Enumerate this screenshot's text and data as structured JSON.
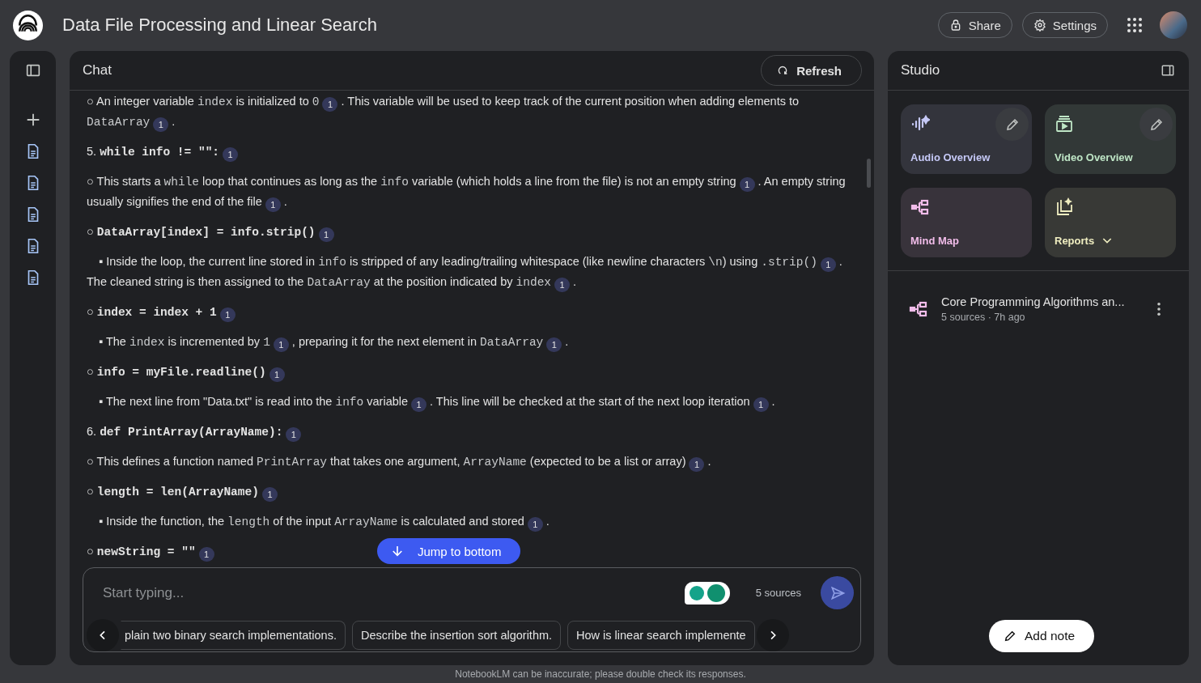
{
  "header": {
    "title": "Data File Processing and Linear Search",
    "buttons": [
      {
        "kind": "share",
        "label": "Share"
      },
      {
        "kind": "settings",
        "label": "Settings"
      }
    ]
  },
  "chat": {
    "title": "Chat",
    "refresh": "Refresh",
    "jump": "Jump to bottom",
    "outline": [
      {
        "children": [
          {
            "bullet": "○",
            "content": [
              {
                "kind": "text",
                "text": "An integer variable "
              },
              {
                "kind": "code",
                "text": "index"
              },
              {
                "kind": "text",
                "text": " is initialized to "
              },
              {
                "kind": "code",
                "text": "0"
              },
              {
                "kind": "cite",
                "text": "1"
              },
              {
                "kind": "text",
                "text": ". This variable will be used to keep track of the current position when adding elements to "
              },
              {
                "kind": "code",
                "text": "DataArray"
              },
              {
                "kind": "cite",
                "text": "1"
              },
              {
                "kind": "text",
                "text": "."
              }
            ]
          }
        ]
      },
      {
        "marker": "5.",
        "content": [
          {
            "kind": "bold-code",
            "text": "while info != \"\":"
          },
          {
            "kind": "cite",
            "text": "1"
          }
        ],
        "children": [
          {
            "bullet": "○",
            "content": [
              {
                "kind": "text",
                "text": "This starts a "
              },
              {
                "kind": "code",
                "text": "while"
              },
              {
                "kind": "text",
                "text": " loop that continues as long as the "
              },
              {
                "kind": "code",
                "text": "info"
              },
              {
                "kind": "text",
                "text": " variable (which holds a line from the file) is not an empty string"
              },
              {
                "kind": "cite",
                "text": "1"
              },
              {
                "kind": "text",
                "text": ". An empty string usually signifies the end of the file"
              },
              {
                "kind": "cite",
                "text": "1"
              },
              {
                "kind": "text",
                "text": "."
              }
            ]
          },
          {
            "bullet": "○",
            "content": [
              {
                "kind": "bold-code",
                "text": "DataArray[index] = info.strip()"
              },
              {
                "kind": "cite",
                "text": "1"
              }
            ],
            "children": [
              {
                "bullet": "▪",
                "content": [
                  {
                    "kind": "text",
                    "text": "Inside the loop, the current line stored in "
                  },
                  {
                    "kind": "code",
                    "text": "info"
                  },
                  {
                    "kind": "text",
                    "text": " is stripped of any leading/trailing whitespace (like newline characters "
                  },
                  {
                    "kind": "code",
                    "text": "\\n"
                  },
                  {
                    "kind": "text",
                    "text": ") using "
                  },
                  {
                    "kind": "code",
                    "text": ".strip()"
                  },
                  {
                    "kind": "cite",
                    "text": "1"
                  },
                  {
                    "kind": "text",
                    "text": ". The cleaned string is then assigned to the "
                  },
                  {
                    "kind": "code",
                    "text": "DataArray"
                  },
                  {
                    "kind": "text",
                    "text": " at the position indicated by "
                  },
                  {
                    "kind": "code",
                    "text": "index"
                  },
                  {
                    "kind": "cite",
                    "text": "1"
                  },
                  {
                    "kind": "text",
                    "text": "."
                  }
                ]
              }
            ]
          },
          {
            "bullet": "○",
            "content": [
              {
                "kind": "bold-code",
                "text": "index = index + 1"
              },
              {
                "kind": "cite",
                "text": "1"
              }
            ],
            "children": [
              {
                "bullet": "▪",
                "content": [
                  {
                    "kind": "text",
                    "text": "The "
                  },
                  {
                    "kind": "code",
                    "text": "index"
                  },
                  {
                    "kind": "text",
                    "text": " is incremented by "
                  },
                  {
                    "kind": "code",
                    "text": "1"
                  },
                  {
                    "kind": "cite",
                    "text": "1"
                  },
                  {
                    "kind": "text",
                    "text": ", preparing it for the next element in "
                  },
                  {
                    "kind": "code",
                    "text": "DataArray"
                  },
                  {
                    "kind": "cite",
                    "text": "1"
                  },
                  {
                    "kind": "text",
                    "text": "."
                  }
                ]
              }
            ]
          },
          {
            "bullet": "○",
            "content": [
              {
                "kind": "bold-code",
                "text": "info = myFile.readline()"
              },
              {
                "kind": "cite",
                "text": "1"
              }
            ],
            "children": [
              {
                "bullet": "▪",
                "content": [
                  {
                    "kind": "text",
                    "text": "The next line from \"Data.txt\" is read into the "
                  },
                  {
                    "kind": "code",
                    "text": "info"
                  },
                  {
                    "kind": "text",
                    "text": " variable"
                  },
                  {
                    "kind": "cite",
                    "text": "1"
                  },
                  {
                    "kind": "text",
                    "text": ". This line will be checked at the start of the next loop iteration"
                  },
                  {
                    "kind": "cite",
                    "text": "1"
                  },
                  {
                    "kind": "text",
                    "text": "."
                  }
                ]
              }
            ]
          }
        ]
      },
      {
        "marker": "6.",
        "content": [
          {
            "kind": "bold-code",
            "text": "def PrintArray(ArrayName):"
          },
          {
            "kind": "cite",
            "text": "1"
          }
        ],
        "children": [
          {
            "bullet": "○",
            "content": [
              {
                "kind": "text",
                "text": "This defines a function named "
              },
              {
                "kind": "code",
                "text": "PrintArray"
              },
              {
                "kind": "text",
                "text": " that takes one argument, "
              },
              {
                "kind": "code",
                "text": "ArrayName"
              },
              {
                "kind": "text",
                "text": " (expected to be a list or array)"
              },
              {
                "kind": "cite",
                "text": "1"
              },
              {
                "kind": "text",
                "text": "."
              }
            ]
          },
          {
            "bullet": "○",
            "content": [
              {
                "kind": "bold-code",
                "text": "length = len(ArrayName)"
              },
              {
                "kind": "cite",
                "text": "1"
              }
            ],
            "children": [
              {
                "bullet": "▪",
                "content": [
                  {
                    "kind": "text",
                    "text": "Inside the function, the "
                  },
                  {
                    "kind": "code",
                    "text": "length"
                  },
                  {
                    "kind": "text",
                    "text": " of the input "
                  },
                  {
                    "kind": "code",
                    "text": "ArrayName"
                  },
                  {
                    "kind": "text",
                    "text": " is calculated and stored"
                  },
                  {
                    "kind": "cite",
                    "text": "1"
                  },
                  {
                    "kind": "text",
                    "text": "."
                  }
                ]
              }
            ]
          },
          {
            "bullet": "○",
            "content": [
              {
                "kind": "bold-code",
                "text": "newString = \"\""
              },
              {
                "kind": "cite",
                "text": "1"
              }
            ]
          }
        ]
      }
    ],
    "input": {
      "placeholder": "Start typing...",
      "sources": "5 sources"
    },
    "suggestions": [
      "plain two binary search implementations.",
      "Describe the insertion sort algorithm.",
      "How is linear search implemente"
    ]
  },
  "studio": {
    "title": "Studio",
    "tiles": [
      {
        "kind": "audio",
        "label": "Audio Overview",
        "color": "#c6c9f7",
        "edit": true,
        "menu": false
      },
      {
        "kind": "video",
        "label": "Video Overview",
        "color": "#bfe6c6",
        "edit": true,
        "menu": false
      },
      {
        "kind": "mindmap",
        "label": "Mind Map",
        "color": "#f2bdea",
        "edit": false,
        "menu": false
      },
      {
        "kind": "reports",
        "label": "Reports",
        "color": "#efedc0",
        "edit": false,
        "menu": true
      }
    ],
    "notes": [
      {
        "kind": "mindmap",
        "title": "Core Programming Algorithms an...",
        "meta": "5 sources · 7h ago"
      }
    ],
    "add_note": "Add note"
  },
  "footer": "NotebookLM can be inaccurate; please double check its responses."
}
